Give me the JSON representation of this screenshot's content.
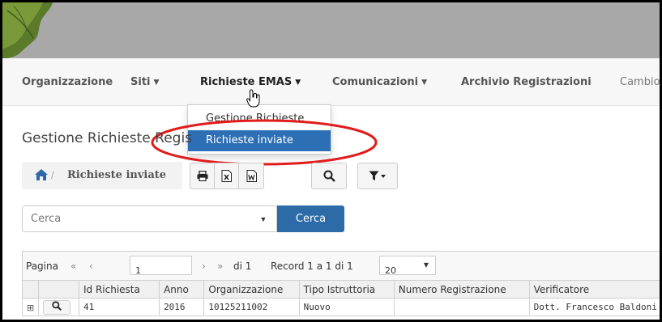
{
  "nav": {
    "items": [
      {
        "label": "Organizzazione",
        "caret": false
      },
      {
        "label": "Siti",
        "caret": true
      },
      {
        "label": "Richieste EMAS",
        "caret": true
      },
      {
        "label": "Comunicazioni",
        "caret": true
      },
      {
        "label": "Archivio Registrazioni",
        "caret": false
      },
      {
        "label": "Cambio",
        "caret": false
      }
    ]
  },
  "dropdown": {
    "items": [
      "Gestione Richieste",
      "Richieste inviate"
    ],
    "selected": "Richieste inviate"
  },
  "page": {
    "title": "Gestione Richieste Regis"
  },
  "breadcrumb": {
    "current": "Richieste inviate"
  },
  "search": {
    "placeholder": "Cerca",
    "button_label": "Cerca"
  },
  "pager": {
    "label": "Pagina",
    "current_page": "1",
    "of_label": "di 1",
    "record_text": "Record 1 a 1 di 1",
    "page_size": "20"
  },
  "table": {
    "columns": [
      "Id Richiesta",
      "Anno",
      "Organizzazione",
      "Tipo Istruttoria",
      "Numero Registrazione",
      "Verificatore"
    ],
    "rows": [
      [
        "41",
        "2016",
        "10125211002",
        "Nuovo",
        "",
        "Dott. Francesco Baldoni"
      ]
    ]
  },
  "colors": {
    "accent": "#2c6aa8",
    "highlight_ellipse": "#e01c1c",
    "header_bg": "#a8a8a8"
  }
}
